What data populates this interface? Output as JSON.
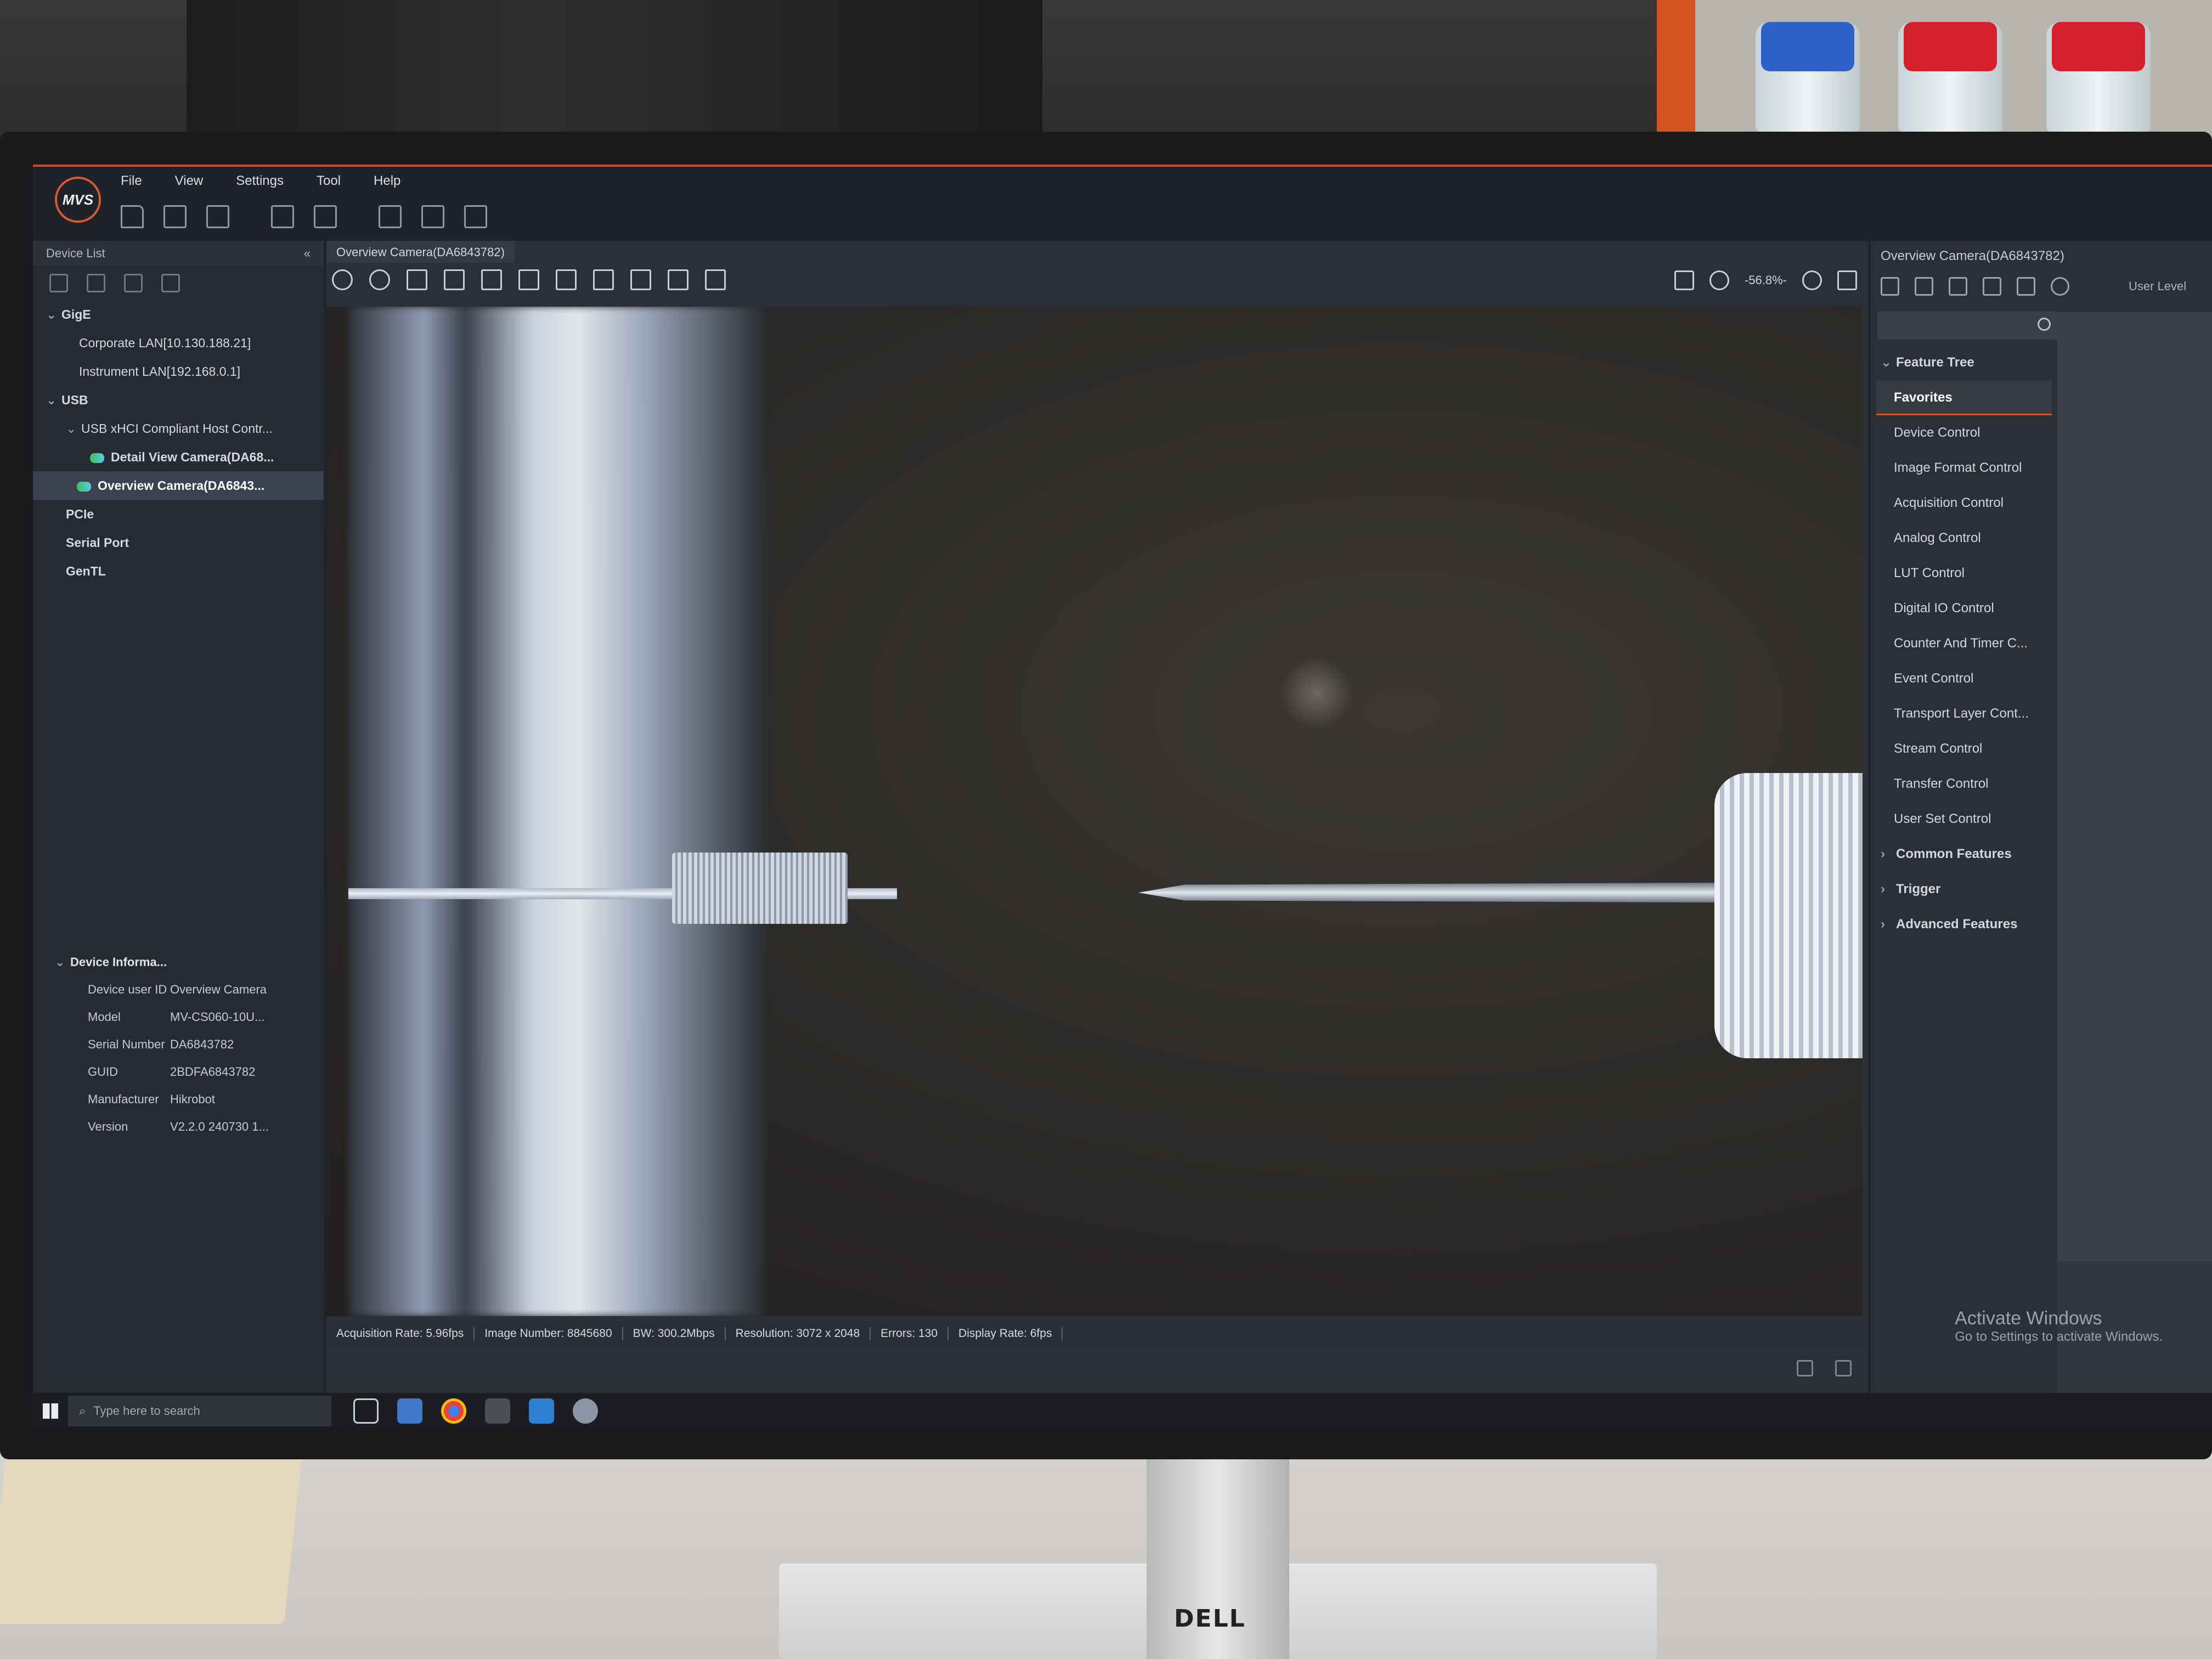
{
  "app": {
    "logo_text": "MVS",
    "menu": [
      "File",
      "View",
      "Settings",
      "Tool",
      "Help"
    ]
  },
  "device_list": {
    "title": "Device List",
    "collapse_glyph": "«",
    "tree": {
      "gige": {
        "label": "GigE",
        "items": [
          "Corporate LAN[10.130.188.21]",
          "Instrument LAN[192.168.0.1]"
        ]
      },
      "usb": {
        "label": "USB",
        "host": "USB xHCI Compliant Host Contr...",
        "cameras": [
          "Detail View Camera(DA68...",
          "Overview Camera(DA6843..."
        ]
      },
      "pcie": "PCIe",
      "serial": "Serial Port",
      "gentl": "GenTL"
    },
    "info": {
      "title": "Device Informa...",
      "rows": [
        {
          "k": "Device user ID",
          "v": "Overview Camera"
        },
        {
          "k": "Model",
          "v": "MV-CS060-10U..."
        },
        {
          "k": "Serial Number",
          "v": "DA6843782"
        },
        {
          "k": "GUID",
          "v": "2BDFA6843782"
        },
        {
          "k": "Manufacturer",
          "v": "Hikrobot"
        },
        {
          "k": "Version",
          "v": "V2.2.0 240730 1..."
        }
      ]
    }
  },
  "viewer": {
    "tab": "Overview Camera(DA6843782)",
    "zoom": "-56.8%-",
    "status": {
      "acq_rate": "Acquisition Rate: 5.96fps",
      "image_number": "Image Number: 8845680",
      "bw": "BW: 300.2Mbps",
      "resolution": "Resolution: 3072 x 2048",
      "errors": "Errors: 130",
      "display_rate": "Display Rate: 6fps"
    }
  },
  "feature_panel": {
    "title": "Overview Camera(DA6843782)",
    "user_level": "User Level",
    "feature_tree": "Feature Tree",
    "favorites": "Favorites",
    "items": [
      "Device Control",
      "Image Format Control",
      "Acquisition Control",
      "Analog Control",
      "LUT Control",
      "Digital IO Control",
      "Counter And Timer C...",
      "Event Control",
      "Transport Layer Cont...",
      "Stream Control",
      "Transfer Control",
      "User Set Control"
    ],
    "groups": [
      "Common Features",
      "Trigger",
      "Advanced Features"
    ]
  },
  "taskbar": {
    "search_placeholder": "Type here to search"
  },
  "activate": {
    "title": "Activate Windows",
    "sub": "Go to Settings to activate Windows."
  },
  "monitor": {
    "brand": "DELL"
  },
  "colors": {
    "accent": "#d2552c",
    "panel": "#262a31",
    "background": "#20232a"
  }
}
